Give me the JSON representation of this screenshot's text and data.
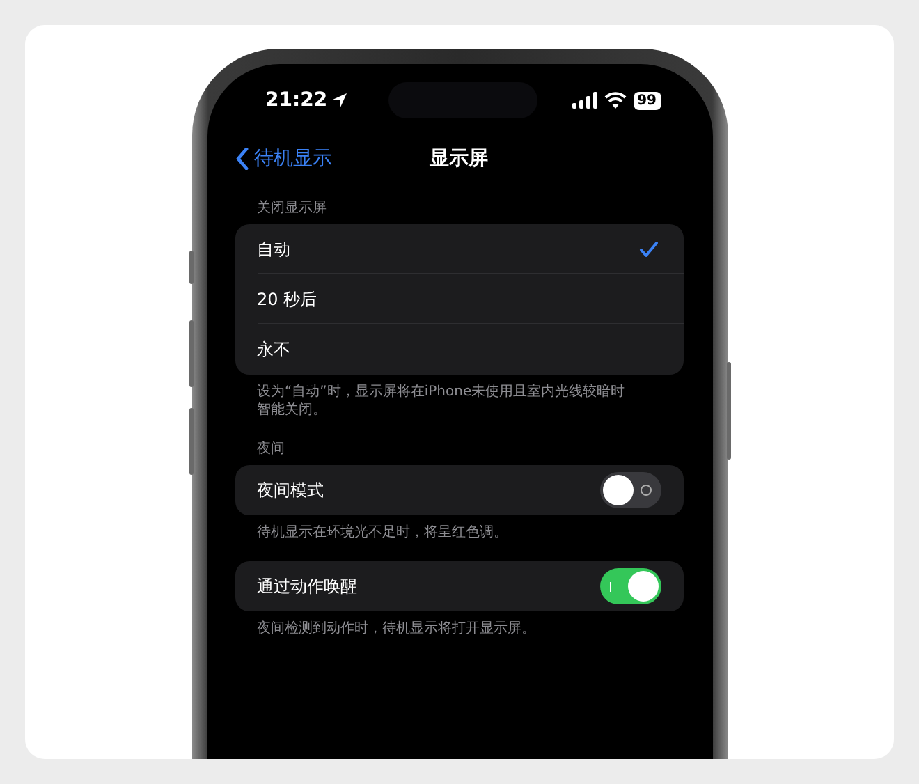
{
  "status_bar": {
    "time": "21:22",
    "battery": "99"
  },
  "nav": {
    "back": "待机显示",
    "title": "显示屏"
  },
  "sections": [
    {
      "header": "关闭显示屏",
      "rows": [
        {
          "kind": "option",
          "label": "自动",
          "selected": true
        },
        {
          "kind": "option",
          "label": "20 秒后",
          "selected": false
        },
        {
          "kind": "option",
          "label": "永不",
          "selected": false
        }
      ],
      "footer": "设为“自动”时，显示屏将在iPhone未使用且室内光线较暗时智能关闭。"
    },
    {
      "header": "夜间",
      "rows": [
        {
          "kind": "toggle",
          "label": "夜间模式",
          "on": false
        }
      ],
      "footer": "待机显示在环境光不足时，将呈红色调。"
    },
    {
      "rows": [
        {
          "kind": "toggle",
          "label": "通过动作唤醒",
          "on": true
        }
      ],
      "footer": "夜间检测到动作时，待机显示将打开显示屏。"
    }
  ]
}
